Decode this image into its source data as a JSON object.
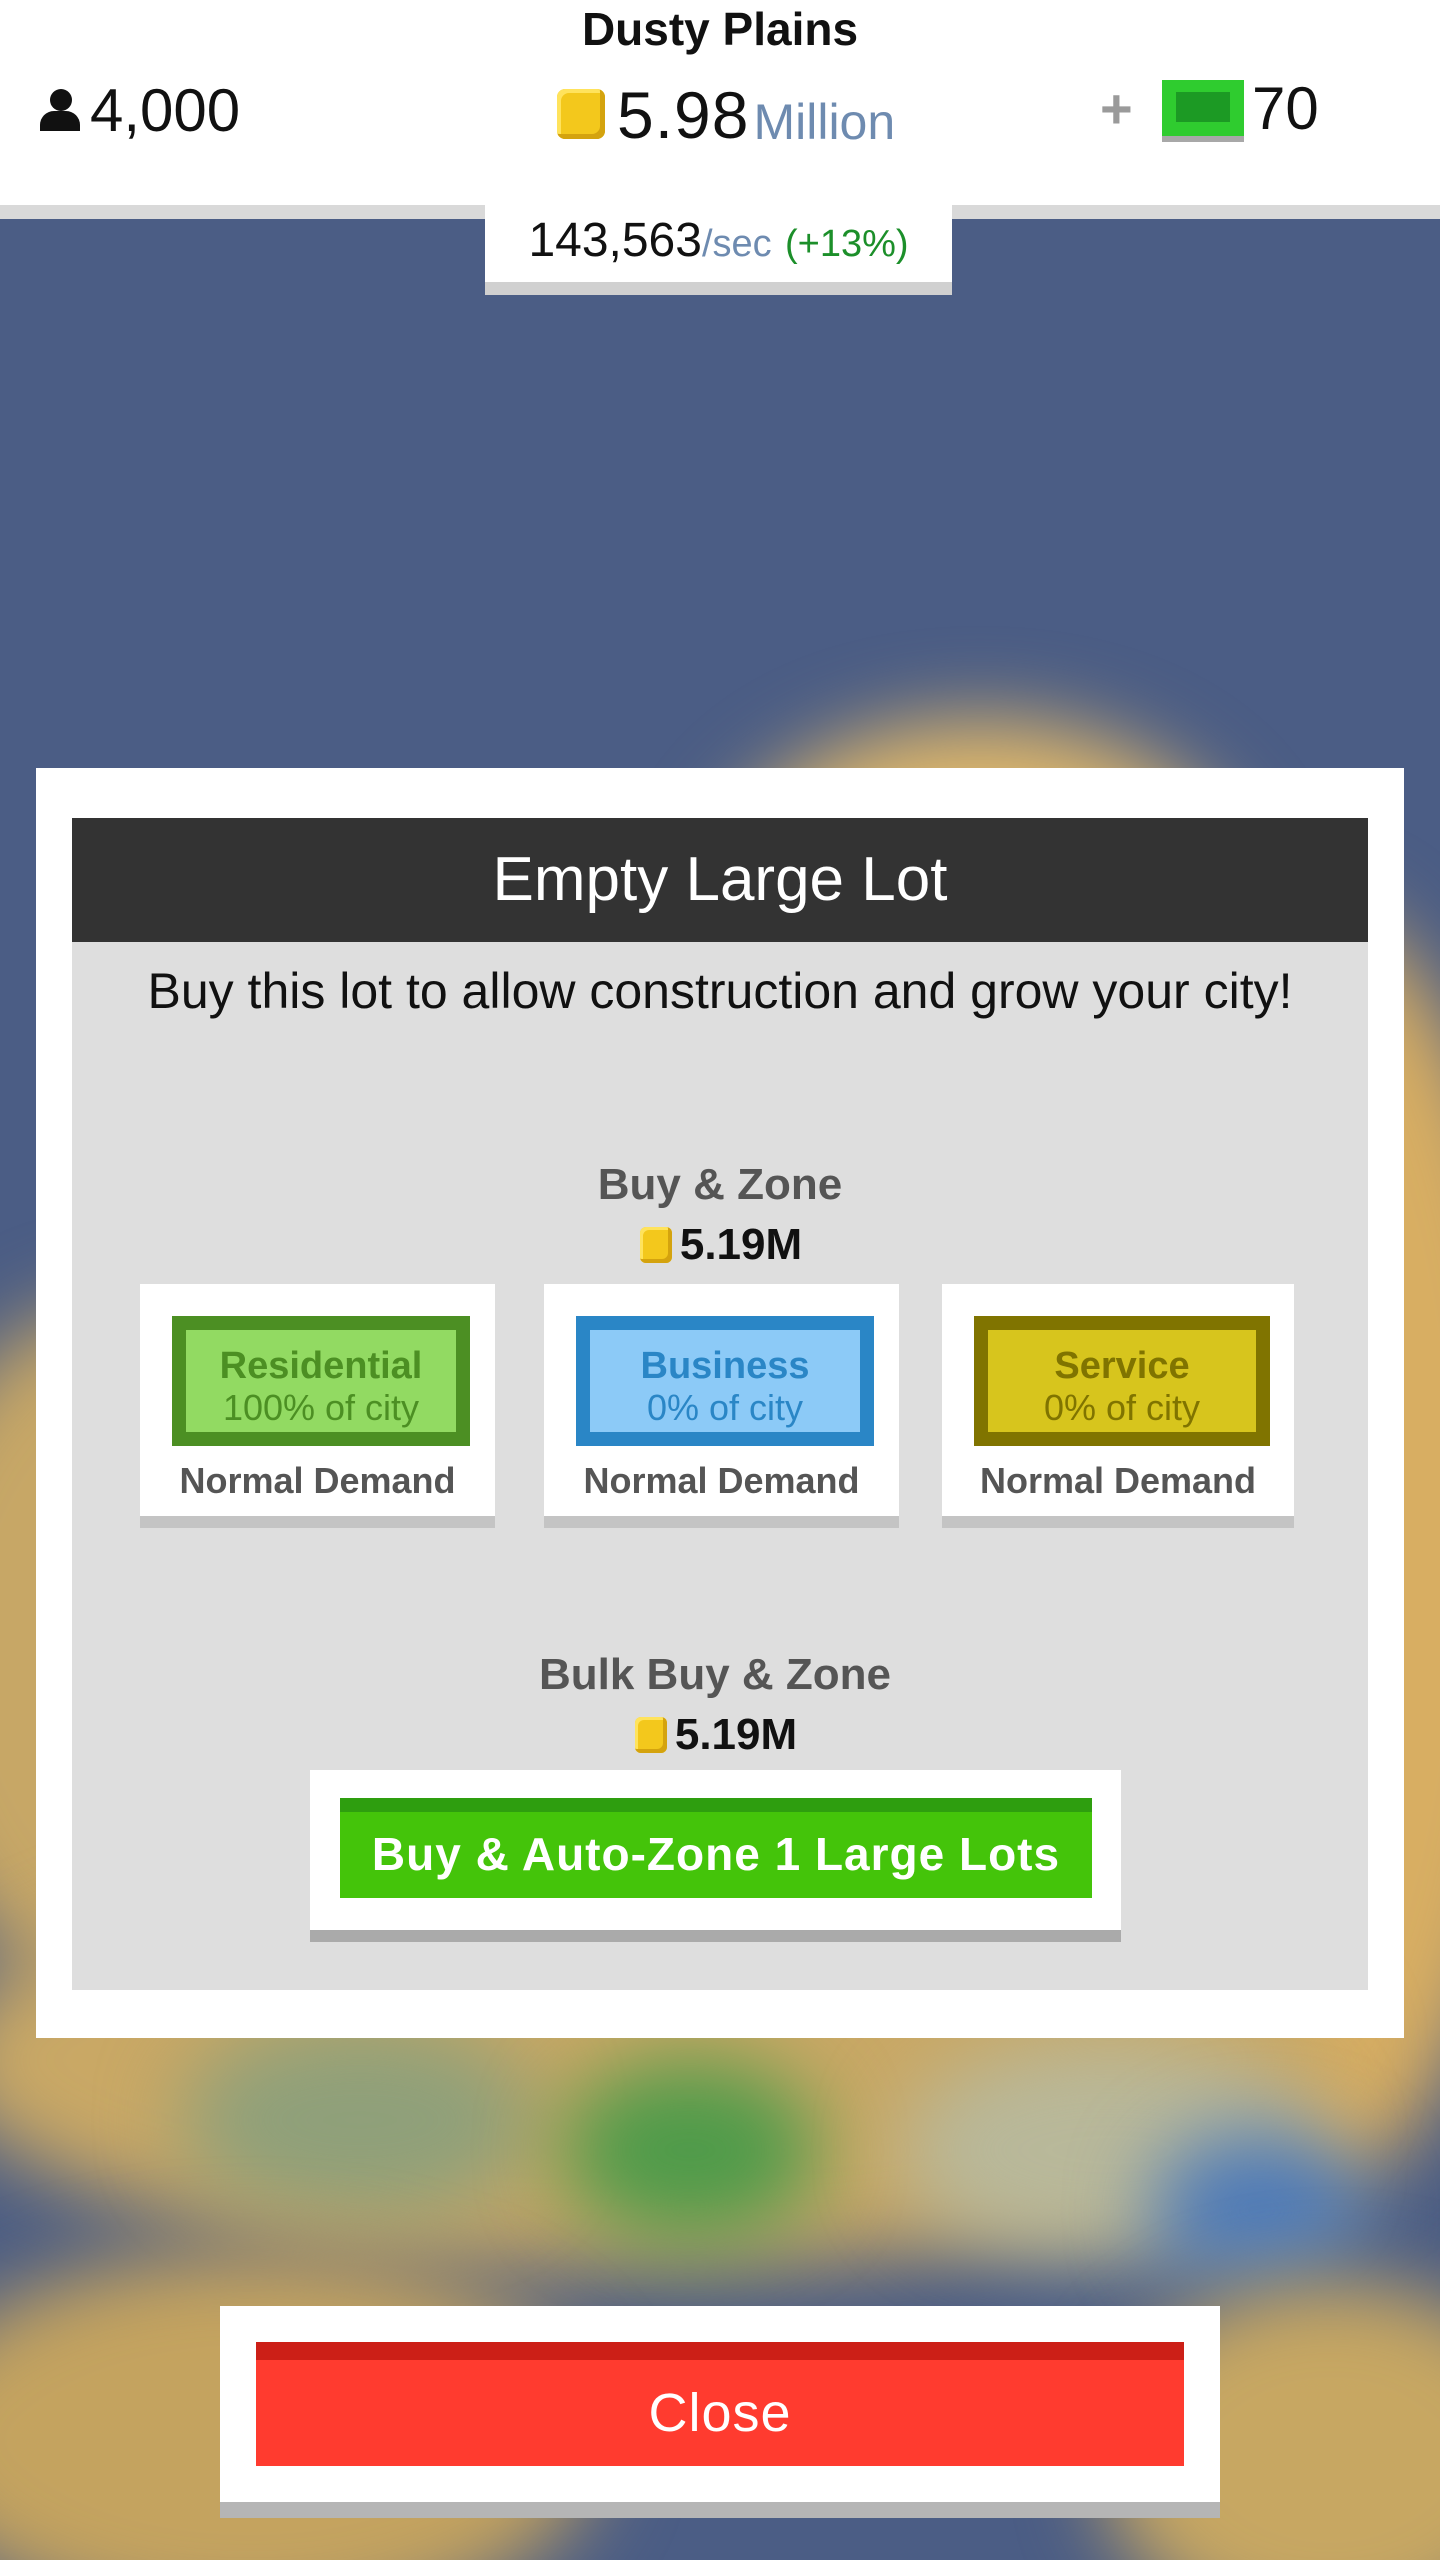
{
  "header": {
    "city_name": "Dusty Plains",
    "population": "4,000",
    "population_icon": "person-icon",
    "money_value": "5.98",
    "money_unit": "Million",
    "money_icon": "coin-icon",
    "plus_label": "+",
    "cash_value": "70",
    "cash_icon": "cash-icon",
    "income_rate": "143,563",
    "income_unit": "/sec",
    "income_bonus": "(+13%)"
  },
  "dialog": {
    "title": "Empty Large Lot",
    "description": "Buy this lot to allow construction and grow your city!",
    "buy_zone": {
      "title": "Buy & Zone",
      "price": "5.19M",
      "zones": [
        {
          "name": "Residential",
          "share": "100% of city",
          "demand": "Normal Demand",
          "fill": "#92da62",
          "border": "#4c8f23",
          "text": "#4c8f23"
        },
        {
          "name": "Business",
          "share": "0% of city",
          "demand": "Normal Demand",
          "fill": "#8ccaf7",
          "border": "#2a86c6",
          "text": "#2a86c6"
        },
        {
          "name": "Service",
          "share": "0% of city",
          "demand": "Normal Demand",
          "fill": "#d7c51d",
          "border": "#807400",
          "text": "#807400"
        }
      ]
    },
    "bulk": {
      "title": "Bulk Buy & Zone",
      "price": "5.19M",
      "button_label": "Buy & Auto-Zone 1 Large Lots"
    }
  },
  "close_label": "Close",
  "colors": {
    "background": "#4b5d85",
    "header_bar": "#333333",
    "panel": "#dedede",
    "bulk_button": "#44c40a",
    "close_button": "#ff3b2f"
  }
}
